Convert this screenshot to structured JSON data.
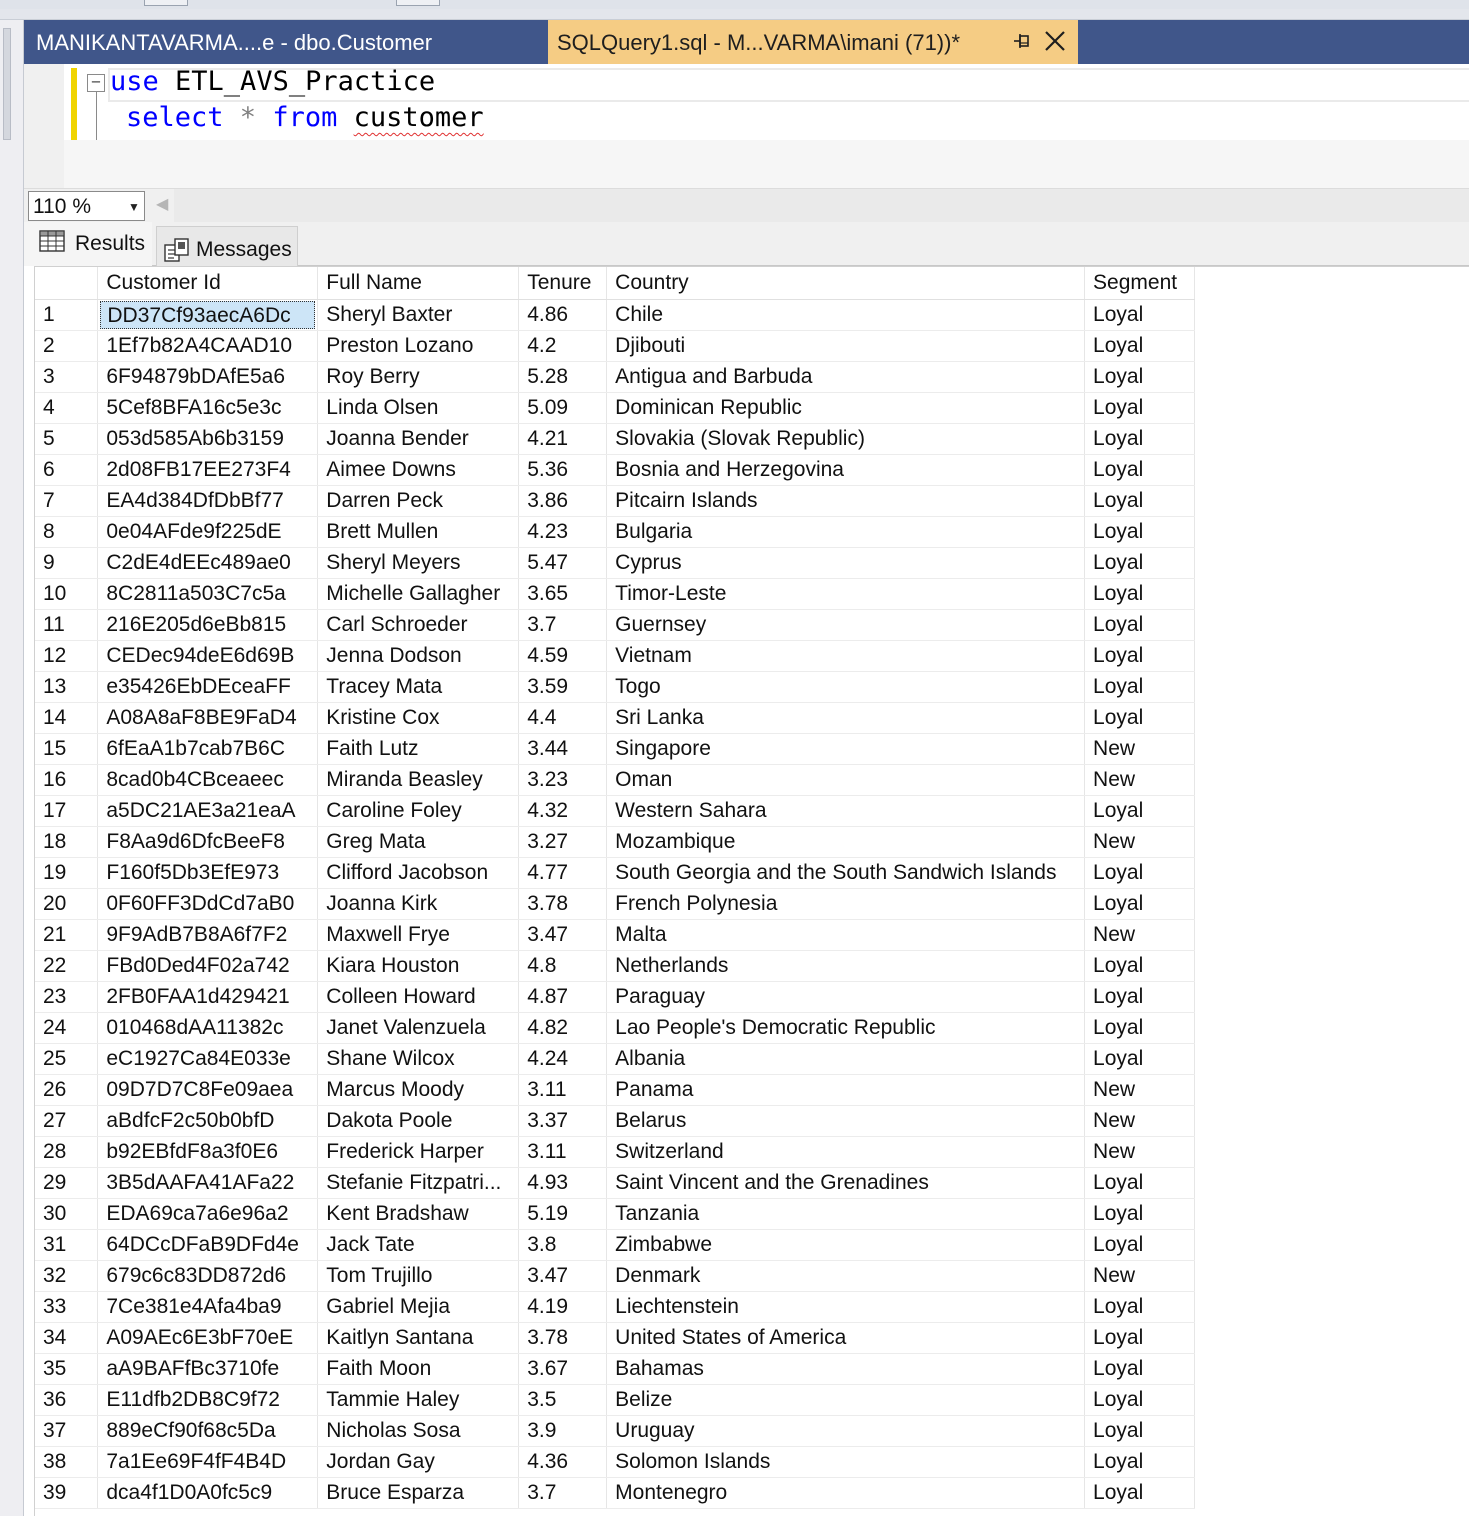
{
  "tabs": {
    "inactive_label": "MANIKANTAVARMA....e - dbo.Customer",
    "active_label": "SQLQuery1.sql - M...VARMA\\imani (71))*",
    "pin_icon": "pin-icon",
    "close_icon": "close-icon"
  },
  "editor": {
    "fold_glyph": "−",
    "line1": {
      "kw": "use",
      "rest": " ETL_AVS_Practice"
    },
    "line2": {
      "kw1": "select",
      "op": " * ",
      "kw2": "from",
      "sp": " ",
      "ident": "customer"
    }
  },
  "zoom": {
    "value": "110 %",
    "caret": "▼",
    "scroll_glyph": "◀"
  },
  "results_tabs": {
    "results": "Results",
    "messages": "Messages"
  },
  "grid": {
    "headers": [
      "",
      "Customer Id",
      "Full Name",
      "Tenure",
      "Country",
      "Segment"
    ],
    "rows": [
      [
        "1",
        "DD37Cf93aecA6Dc",
        "Sheryl Baxter",
        "4.86",
        "Chile",
        "Loyal"
      ],
      [
        "2",
        "1Ef7b82A4CAAD10",
        "Preston Lozano",
        "4.2",
        "Djibouti",
        "Loyal"
      ],
      [
        "3",
        "6F94879bDAfE5a6",
        "Roy Berry",
        "5.28",
        "Antigua and Barbuda",
        "Loyal"
      ],
      [
        "4",
        "5Cef8BFA16c5e3c",
        "Linda Olsen",
        "5.09",
        "Dominican Republic",
        "Loyal"
      ],
      [
        "5",
        "053d585Ab6b3159",
        "Joanna Bender",
        "4.21",
        "Slovakia (Slovak Republic)",
        "Loyal"
      ],
      [
        "6",
        "2d08FB17EE273F4",
        "Aimee Downs",
        "5.36",
        "Bosnia and Herzegovina",
        "Loyal"
      ],
      [
        "7",
        "EA4d384DfDbBf77",
        "Darren Peck",
        "3.86",
        "Pitcairn Islands",
        "Loyal"
      ],
      [
        "8",
        "0e04AFde9f225dE",
        "Brett Mullen",
        "4.23",
        "Bulgaria",
        "Loyal"
      ],
      [
        "9",
        "C2dE4dEEc489ae0",
        "Sheryl Meyers",
        "5.47",
        "Cyprus",
        "Loyal"
      ],
      [
        "10",
        "8C2811a503C7c5a",
        "Michelle Gallagher",
        "3.65",
        "Timor-Leste",
        "Loyal"
      ],
      [
        "11",
        "216E205d6eBb815",
        "Carl Schroeder",
        "3.7",
        "Guernsey",
        "Loyal"
      ],
      [
        "12",
        "CEDec94deE6d69B",
        "Jenna Dodson",
        "4.59",
        "Vietnam",
        "Loyal"
      ],
      [
        "13",
        "e35426EbDEceaFF",
        "Tracey Mata",
        "3.59",
        "Togo",
        "Loyal"
      ],
      [
        "14",
        "A08A8aF8BE9FaD4",
        "Kristine Cox",
        "4.4",
        "Sri Lanka",
        "Loyal"
      ],
      [
        "15",
        "6fEaA1b7cab7B6C",
        "Faith Lutz",
        "3.44",
        "Singapore",
        "New"
      ],
      [
        "16",
        "8cad0b4CBceaeec",
        "Miranda Beasley",
        "3.23",
        "Oman",
        "New"
      ],
      [
        "17",
        "a5DC21AE3a21eaA",
        "Caroline Foley",
        "4.32",
        "Western Sahara",
        "Loyal"
      ],
      [
        "18",
        "F8Aa9d6DfcBeeF8",
        "Greg Mata",
        "3.27",
        "Mozambique",
        "New"
      ],
      [
        "19",
        "F160f5Db3EfE973",
        "Clifford Jacobson",
        "4.77",
        "South Georgia and the South Sandwich Islands",
        "Loyal"
      ],
      [
        "20",
        "0F60FF3DdCd7aB0",
        "Joanna Kirk",
        "3.78",
        "French Polynesia",
        "Loyal"
      ],
      [
        "21",
        "9F9AdB7B8A6f7F2",
        "Maxwell Frye",
        "3.47",
        "Malta",
        "New"
      ],
      [
        "22",
        "FBd0Ded4F02a742",
        "Kiara Houston",
        "4.8",
        "Netherlands",
        "Loyal"
      ],
      [
        "23",
        "2FB0FAA1d429421",
        "Colleen Howard",
        "4.87",
        "Paraguay",
        "Loyal"
      ],
      [
        "24",
        "010468dAA11382c",
        "Janet Valenzuela",
        "4.82",
        "Lao People's Democratic Republic",
        "Loyal"
      ],
      [
        "25",
        "eC1927Ca84E033e",
        "Shane Wilcox",
        "4.24",
        "Albania",
        "Loyal"
      ],
      [
        "26",
        "09D7D7C8Fe09aea",
        "Marcus Moody",
        "3.11",
        "Panama",
        "New"
      ],
      [
        "27",
        "aBdfcF2c50b0bfD",
        "Dakota Poole",
        "3.37",
        "Belarus",
        "New"
      ],
      [
        "28",
        "b92EBfdF8a3f0E6",
        "Frederick Harper",
        "3.11",
        "Switzerland",
        "New"
      ],
      [
        "29",
        "3B5dAAFA41AFa22",
        "Stefanie Fitzpatri...",
        "4.93",
        "Saint Vincent and the Grenadines",
        "Loyal"
      ],
      [
        "30",
        "EDA69ca7a6e96a2",
        "Kent Bradshaw",
        "5.19",
        "Tanzania",
        "Loyal"
      ],
      [
        "31",
        "64DCcDFaB9DFd4e",
        "Jack Tate",
        "3.8",
        "Zimbabwe",
        "Loyal"
      ],
      [
        "32",
        "679c6c83DD872d6",
        "Tom Trujillo",
        "3.47",
        "Denmark",
        "New"
      ],
      [
        "33",
        "7Ce381e4Afa4ba9",
        "Gabriel Mejia",
        "4.19",
        "Liechtenstein",
        "Loyal"
      ],
      [
        "34",
        "A09AEc6E3bF70eE",
        "Kaitlyn Santana",
        "3.78",
        "United States of America",
        "Loyal"
      ],
      [
        "35",
        "aA9BAFfBc3710fe",
        "Faith Moon",
        "3.67",
        "Bahamas",
        "Loyal"
      ],
      [
        "36",
        "E11dfb2DB8C9f72",
        "Tammie Haley",
        "3.5",
        "Belize",
        "Loyal"
      ],
      [
        "37",
        "889eCf90f68c5Da",
        "Nicholas Sosa",
        "3.9",
        "Uruguay",
        "Loyal"
      ],
      [
        "38",
        "7a1Ee69F4fF4B4D",
        "Jordan Gay",
        "4.36",
        "Solomon Islands",
        "Loyal"
      ],
      [
        "39",
        "dca4f1D0A0fc5c9",
        "Bruce Esparza",
        "3.7",
        "Montenegro",
        "Loyal"
      ]
    ]
  }
}
